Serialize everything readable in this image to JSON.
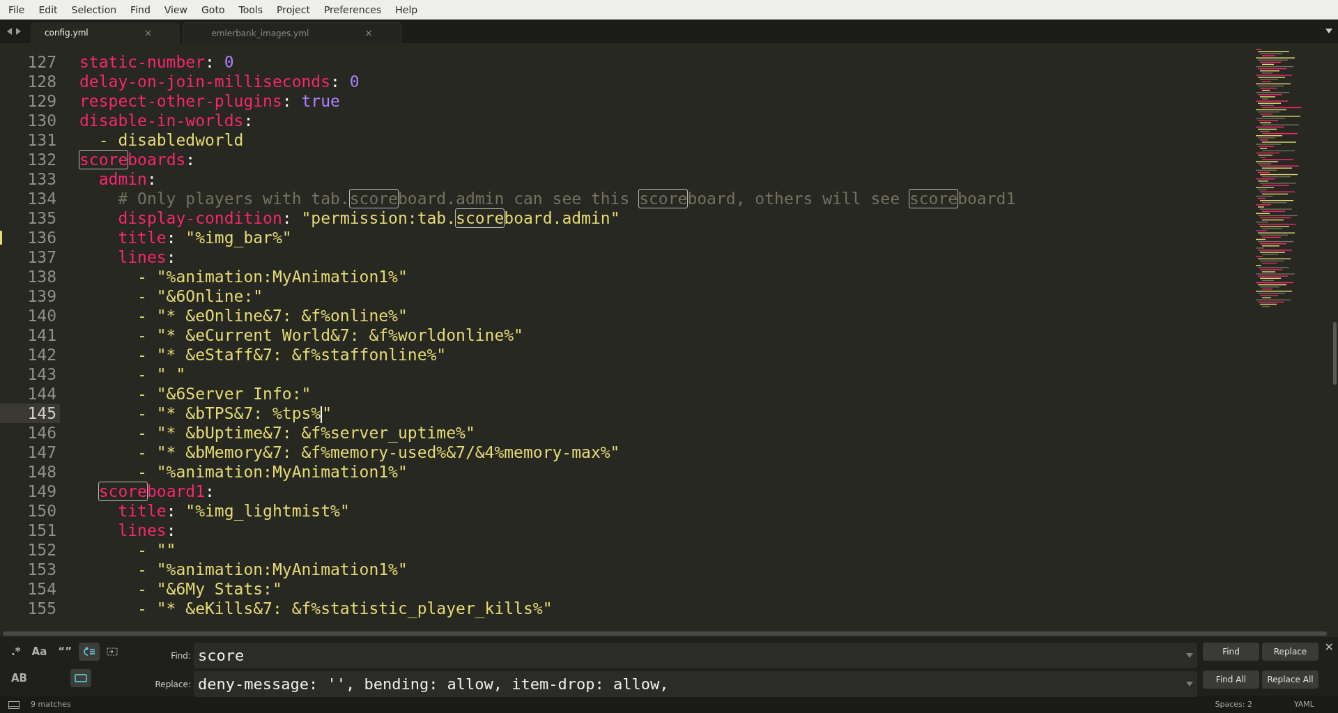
{
  "menu": [
    "File",
    "Edit",
    "Selection",
    "Find",
    "View",
    "Goto",
    "Tools",
    "Project",
    "Preferences",
    "Help"
  ],
  "tabs": [
    {
      "label": "config.yml",
      "selected": true,
      "close": "×"
    },
    {
      "label": "emlerbank_images.yml",
      "selected": false,
      "close": "×"
    }
  ],
  "lines": [
    {
      "number": "127",
      "current": false,
      "modified": false,
      "tokens": [
        {
          "kind": "key",
          "text": "static-number"
        },
        {
          "kind": "punct",
          "text": ": "
        },
        {
          "kind": "number",
          "text": "0"
        }
      ]
    },
    {
      "number": "128",
      "current": false,
      "modified": false,
      "tokens": [
        {
          "kind": "key",
          "text": "delay-on-join-milliseconds"
        },
        {
          "kind": "punct",
          "text": ": "
        },
        {
          "kind": "number",
          "text": "0"
        }
      ]
    },
    {
      "number": "129",
      "current": false,
      "modified": false,
      "tokens": [
        {
          "kind": "key",
          "text": "respect-other-plugins"
        },
        {
          "kind": "punct",
          "text": ": "
        },
        {
          "kind": "number",
          "text": "true"
        }
      ]
    },
    {
      "number": "130",
      "current": false,
      "modified": false,
      "tokens": [
        {
          "kind": "key",
          "text": "disable-in-worlds"
        },
        {
          "kind": "punct",
          "text": ":"
        }
      ]
    },
    {
      "number": "131",
      "current": false,
      "modified": false,
      "tokens": [
        {
          "kind": "string",
          "text": "  - disabledworld"
        }
      ]
    },
    {
      "number": "132",
      "current": false,
      "modified": false,
      "tokens": [
        {
          "kind": "key",
          "text": "score",
          "match": true
        },
        {
          "kind": "key",
          "text": "boards"
        },
        {
          "kind": "punct",
          "text": ":"
        }
      ]
    },
    {
      "number": "133",
      "current": false,
      "modified": false,
      "tokens": [
        {
          "kind": "key",
          "text": "  admin"
        },
        {
          "kind": "punct",
          "text": ":"
        }
      ]
    },
    {
      "number": "134",
      "current": false,
      "modified": false,
      "tokens": [
        {
          "kind": "comment",
          "text": "    # Only players with tab."
        },
        {
          "kind": "comment",
          "text": "score",
          "match": true
        },
        {
          "kind": "comment",
          "text": "board.admin can see this "
        },
        {
          "kind": "comment",
          "text": "score",
          "match": true
        },
        {
          "kind": "comment",
          "text": "board, others will see "
        },
        {
          "kind": "comment",
          "text": "score",
          "match": true
        },
        {
          "kind": "comment",
          "text": "board1"
        }
      ]
    },
    {
      "number": "135",
      "current": false,
      "modified": false,
      "tokens": [
        {
          "kind": "key",
          "text": "    display-condition"
        },
        {
          "kind": "punct",
          "text": ": "
        },
        {
          "kind": "string",
          "text": "\"permission:tab."
        },
        {
          "kind": "string",
          "text": "score",
          "match": true
        },
        {
          "kind": "string",
          "text": "board.admin\""
        }
      ]
    },
    {
      "number": "136",
      "current": false,
      "modified": true,
      "tokens": [
        {
          "kind": "key",
          "text": "    title"
        },
        {
          "kind": "punct",
          "text": ": "
        },
        {
          "kind": "string",
          "text": "\"%img_bar%\""
        }
      ]
    },
    {
      "number": "137",
      "current": false,
      "modified": false,
      "tokens": [
        {
          "kind": "key",
          "text": "    lines"
        },
        {
          "kind": "punct",
          "text": ":"
        }
      ]
    },
    {
      "number": "138",
      "current": false,
      "modified": false,
      "tokens": [
        {
          "kind": "string",
          "text": "      - \"%animation:MyAnimation1%\""
        }
      ]
    },
    {
      "number": "139",
      "current": false,
      "modified": false,
      "tokens": [
        {
          "kind": "string",
          "text": "      - \"&6Online:\""
        }
      ]
    },
    {
      "number": "140",
      "current": false,
      "modified": false,
      "tokens": [
        {
          "kind": "string",
          "text": "      - \"* &eOnline&7: &f%online%\""
        }
      ]
    },
    {
      "number": "141",
      "current": false,
      "modified": false,
      "tokens": [
        {
          "kind": "string",
          "text": "      - \"* &eCurrent World&7: &f%worldonline%\""
        }
      ]
    },
    {
      "number": "142",
      "current": false,
      "modified": false,
      "tokens": [
        {
          "kind": "string",
          "text": "      - \"* &eStaff&7: &f%staffonline%\""
        }
      ]
    },
    {
      "number": "143",
      "current": false,
      "modified": false,
      "tokens": [
        {
          "kind": "string",
          "text": "      - \" \""
        }
      ]
    },
    {
      "number": "144",
      "current": false,
      "modified": false,
      "tokens": [
        {
          "kind": "string",
          "text": "      - \"&6Server Info:\""
        }
      ]
    },
    {
      "number": "145",
      "current": true,
      "modified": false,
      "tokens": [
        {
          "kind": "string",
          "text": "      - \"* &bTPS&7: %tps%",
          "caret": true
        },
        {
          "kind": "string",
          "text": "\""
        }
      ]
    },
    {
      "number": "146",
      "current": false,
      "modified": false,
      "tokens": [
        {
          "kind": "string",
          "text": "      - \"* &bUptime&7: &f%server_uptime%\""
        }
      ]
    },
    {
      "number": "147",
      "current": false,
      "modified": false,
      "tokens": [
        {
          "kind": "string",
          "text": "      - \"* &bMemory&7: &f%memory-used%&7/&4%memory-max%\""
        }
      ]
    },
    {
      "number": "148",
      "current": false,
      "modified": false,
      "tokens": [
        {
          "kind": "string",
          "text": "      - \"%animation:MyAnimation1%\""
        }
      ]
    },
    {
      "number": "149",
      "current": false,
      "modified": false,
      "tokens": [
        {
          "kind": "key",
          "text": "  score",
          "match": true
        },
        {
          "kind": "key",
          "text": "board1"
        },
        {
          "kind": "punct",
          "text": ":"
        }
      ]
    },
    {
      "number": "150",
      "current": false,
      "modified": false,
      "tokens": [
        {
          "kind": "key",
          "text": "    title"
        },
        {
          "kind": "punct",
          "text": ": "
        },
        {
          "kind": "string",
          "text": "\"%img_lightmist%\""
        }
      ]
    },
    {
      "number": "151",
      "current": false,
      "modified": false,
      "tokens": [
        {
          "kind": "key",
          "text": "    lines"
        },
        {
          "kind": "punct",
          "text": ":"
        }
      ]
    },
    {
      "number": "152",
      "current": false,
      "modified": false,
      "tokens": [
        {
          "kind": "string",
          "text": "      - \"\""
        }
      ]
    },
    {
      "number": "153",
      "current": false,
      "modified": false,
      "tokens": [
        {
          "kind": "string",
          "text": "      - \"%animation:MyAnimation1%\""
        }
      ]
    },
    {
      "number": "154",
      "current": false,
      "modified": false,
      "tokens": [
        {
          "kind": "string",
          "text": "      - \"&6My Stats:\""
        }
      ]
    },
    {
      "number": "155",
      "current": false,
      "modified": false,
      "tokens": [
        {
          "kind": "string",
          "text": "      - \"* &eKills&7: &f%statistic_player_kills%\""
        }
      ]
    }
  ],
  "find_panel": {
    "options_row_1": [
      {
        "kind": "text",
        "label": ".*",
        "selected": false
      },
      {
        "kind": "text",
        "label": "Aa",
        "selected": false
      },
      {
        "kind": "text",
        "label": "“”",
        "selected": false
      },
      {
        "kind": "wrap",
        "selected": true
      },
      {
        "kind": "in-selection",
        "selected": false
      }
    ],
    "options_row_2": [
      {
        "kind": "text",
        "label": "AB",
        "selected": false
      },
      {
        "kind": "highlight",
        "selected": true
      }
    ],
    "find_label": "Find:",
    "find_value": "score",
    "replace_label": "Replace:",
    "replace_value": "deny-message: '', bending: allow, item-drop: allow,",
    "buttons": [
      "Find",
      "Replace",
      "Find All",
      "Replace All"
    ],
    "close": "×"
  },
  "status_bar": {
    "matches": "9 matches",
    "indentation": "Spaces: 2",
    "syntax": "YAML"
  }
}
